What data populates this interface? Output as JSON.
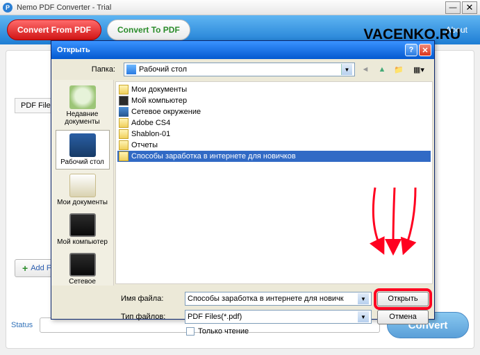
{
  "app": {
    "title": "Nemo PDF Converter - Trial",
    "icon_letter": "P",
    "toolbar": {
      "btn1": "Convert From PDF",
      "btn2": "Convert To PDF",
      "about": "About"
    },
    "pdf_file_label": "PDF File",
    "add_files": "Add Files",
    "status_label": "Status",
    "convert": "Convert"
  },
  "watermark": "VACENKO.RU",
  "dialog": {
    "title": "Открыть",
    "folder_label": "Папка:",
    "folder_selected": "Рабочий стол",
    "places": [
      {
        "label": "Недавние документы"
      },
      {
        "label": "Рабочий стол"
      },
      {
        "label": "Мои документы"
      },
      {
        "label": "Мой компьютер"
      },
      {
        "label": "Сетевое"
      }
    ],
    "files": [
      {
        "name": "Мои документы",
        "icon": "fi-folder"
      },
      {
        "name": "Мой компьютер",
        "icon": "fi-comp-ico"
      },
      {
        "name": "Сетевое окружение",
        "icon": "fi-net-ico"
      },
      {
        "name": "Adobe CS4",
        "icon": "fi-folder"
      },
      {
        "name": "Shablon-01",
        "icon": "fi-folder"
      },
      {
        "name": "Отчеты",
        "icon": "fi-folder"
      },
      {
        "name": "Способы заработка в интернете для новичков",
        "icon": "fi-folder"
      }
    ],
    "selected_index": 6,
    "filename_label": "Имя файла:",
    "filename_value": "Способы заработка в интернете для новичк",
    "filetype_label": "Тип файлов:",
    "filetype_value": "PDF Files(*.pdf)",
    "open_btn": "Открыть",
    "cancel_btn": "Отмена",
    "readonly_label": "Только чтение"
  }
}
